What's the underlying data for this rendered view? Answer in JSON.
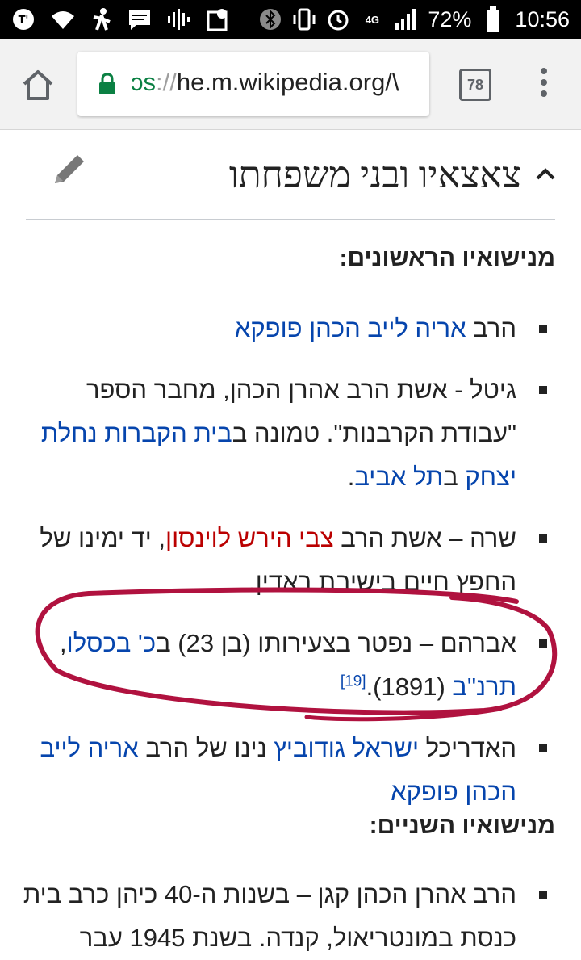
{
  "status_bar": {
    "battery": "72%",
    "time": "10:56",
    "network": "4G",
    "icons_left": [
      "app-icon",
      "wifi-icon",
      "walk-icon",
      "message-icon",
      "voicemail-icon",
      "maps-icon"
    ],
    "icons_right": [
      "bluetooth-icon",
      "vibrate-icon",
      "alarm-icon",
      "signal-icon",
      "battery-icon"
    ]
  },
  "browser": {
    "url_scheme": "ɔs",
    "url_sep": "://",
    "url_host": "he.m.wikipedia.org/\\",
    "tab_count": "78"
  },
  "section": {
    "title": "צאצאיו ובני משפחתו"
  },
  "subheading_first": "מנישואיו הראשונים:",
  "items_first": [
    {
      "t1": "הרב ",
      "link1": "אריה לייב הכהן פופקא"
    },
    {
      "t1": "גיטל - אשת הרב אהרן הכהן, מחבר הספר \"עבודת הקרבנות\". טמונה ב",
      "link1": "בית הקברות נחלת יצחק",
      "t2": " ב",
      "link2": "תל אביב",
      "t3": "."
    },
    {
      "t1": "שרה – אשת הרב ",
      "link_red": "צבי הירש לוינסון",
      "t2": ", יד ימינו של החפץ חיים בישיבת ראדין."
    },
    {
      "t1": "אברהם – נפטר בצעירותו (בן 23) ב",
      "link1": "כ' בכסלו",
      "t2": ", ",
      "link2": "תרנ\"ב",
      "t3": " (1891).",
      "ref": "[19]"
    },
    {
      "t1": "האדריכל ",
      "link1": "ישראל גודוביץ",
      "t2": " נינו של הרב ",
      "link2": "אריה לייב הכהן פופקא"
    }
  ],
  "subheading_second": "מנישואיו השניים:",
  "items_second": [
    {
      "t1": "הרב אהרן הכהן קגן – בשנות ה-40 כיהן כרב בית כנסת במונטריאול, קנדה. בשנת 1945 עבר"
    }
  ],
  "colors": {
    "link": "#0645ad",
    "redlink": "#ba0000",
    "annotation": "#b0123f"
  }
}
